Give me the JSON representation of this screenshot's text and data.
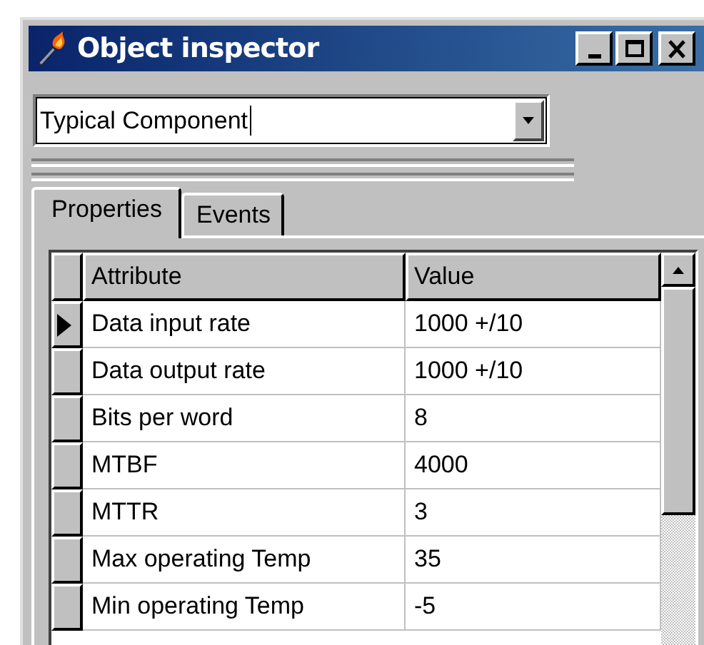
{
  "window": {
    "title": "Object inspector"
  },
  "component_select": {
    "value": "Typical Component"
  },
  "tabs": [
    {
      "label": "Properties",
      "selected": true
    },
    {
      "label": "Events",
      "selected": false
    }
  ],
  "grid": {
    "columns": [
      "Attribute",
      "Value"
    ],
    "rows": [
      {
        "attribute": "Data input rate",
        "value": "1000 +/10",
        "selected": true
      },
      {
        "attribute": "Data output rate",
        "value": "1000 +/10",
        "selected": false
      },
      {
        "attribute": "Bits per word",
        "value": "8",
        "selected": false
      },
      {
        "attribute": "MTBF",
        "value": "4000",
        "selected": false
      },
      {
        "attribute": "MTTR",
        "value": "3",
        "selected": false
      },
      {
        "attribute": "Max operating Temp",
        "value": "35",
        "selected": false
      },
      {
        "attribute": "Min operating Temp",
        "value": "-5",
        "selected": false
      }
    ]
  }
}
